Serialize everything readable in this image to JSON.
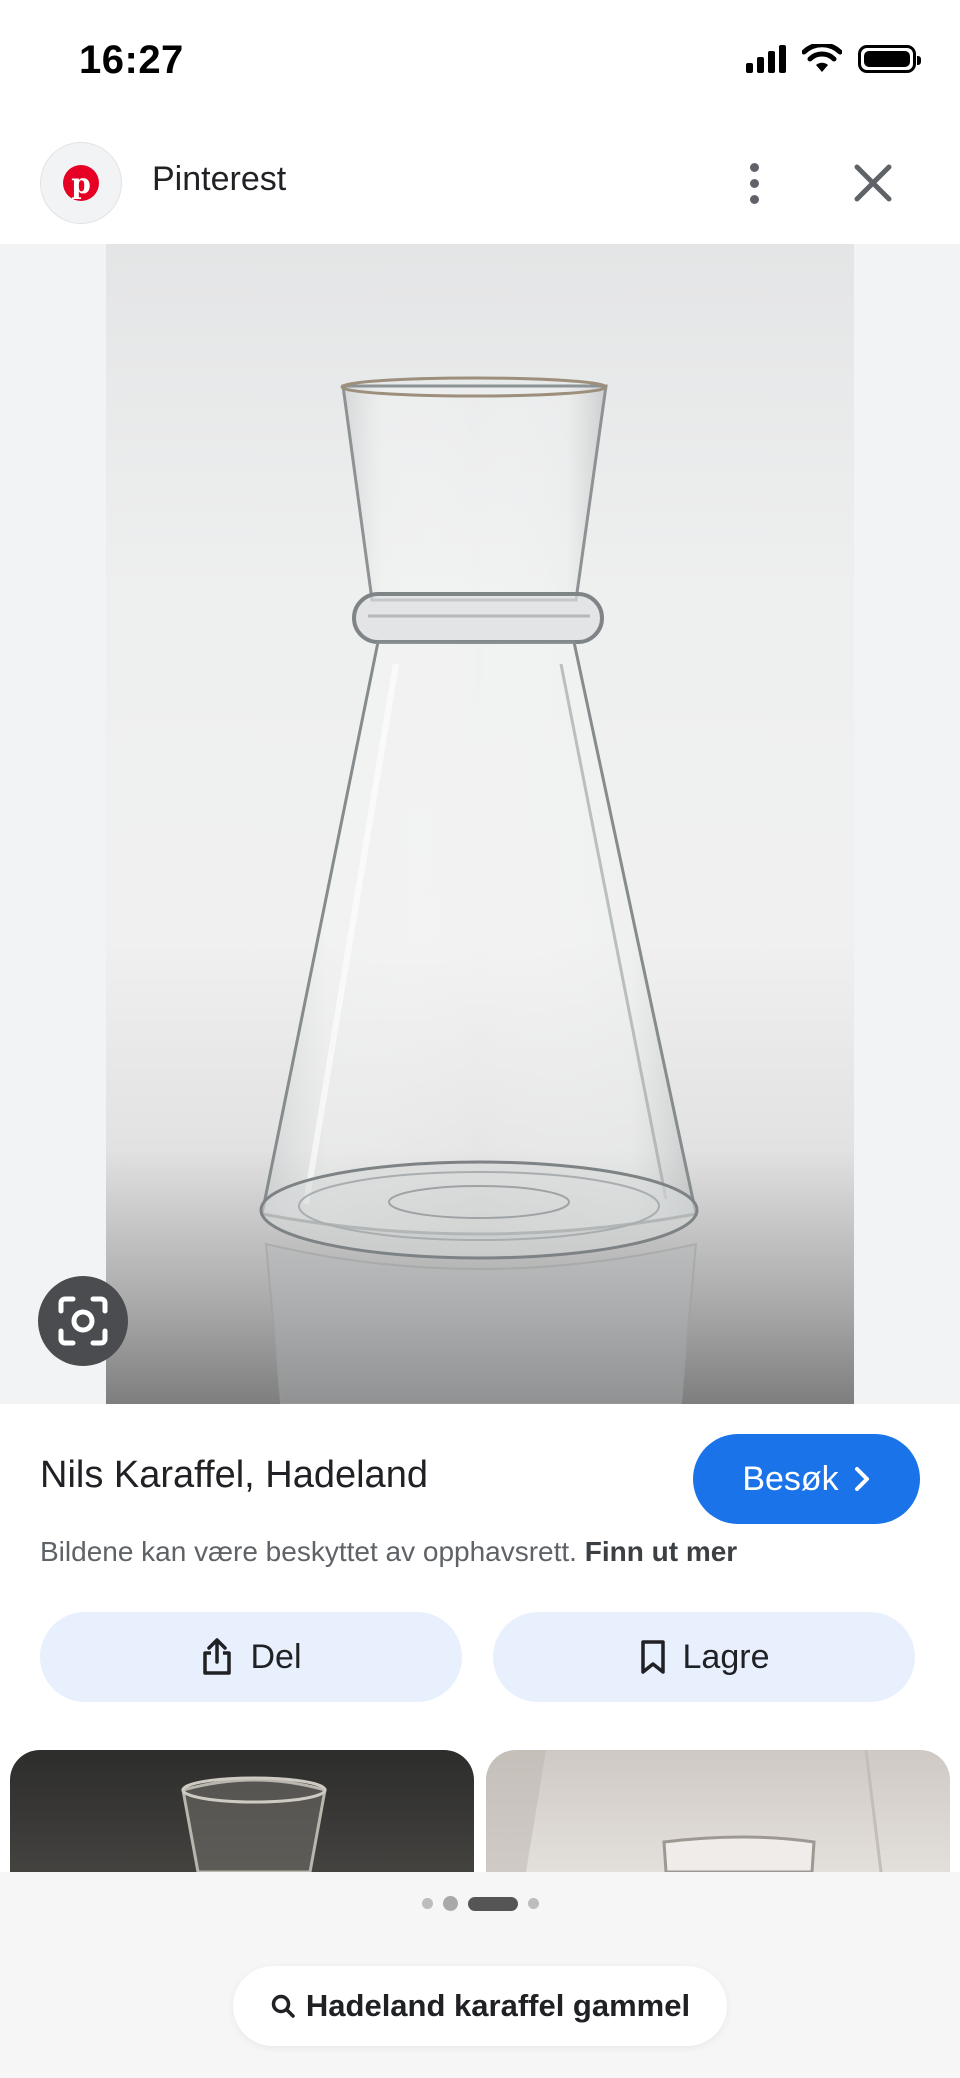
{
  "status_bar": {
    "time": "16:27",
    "icons": [
      "cellular-signal-icon",
      "wifi-icon",
      "battery-icon"
    ]
  },
  "header": {
    "site_logo_icon": "pinterest-logo",
    "site_name": "Pinterest",
    "more_icon": "more-vert-icon",
    "close_icon": "close-icon"
  },
  "image": {
    "lens_icon": "camera-lens-icon"
  },
  "info": {
    "title": "Nils Karaffel, Hadeland",
    "visit_label": "Besøk",
    "copyright_text": "Bildene kan være beskyttet av opphavsrett.",
    "copyright_link": "Finn ut mer",
    "share_label": "Del",
    "save_label": "Lagre"
  },
  "colors": {
    "visit_button": "#1a73e8",
    "action_button_bg": "#e8f0fe",
    "pinterest_red": "#e60023"
  },
  "pagination": {
    "total": 4,
    "active_index": 2
  },
  "search_query": {
    "text": "Hadeland karaffel gammel",
    "icon": "search-icon"
  }
}
